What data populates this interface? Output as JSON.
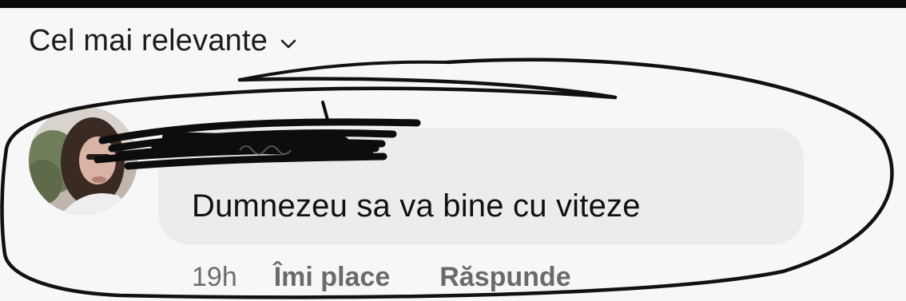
{
  "sort": {
    "label": "Cel mai relevante",
    "chevron_icon": "chevron-down-icon"
  },
  "comment": {
    "avatar_icon": "user-avatar",
    "author_name_redaction": "scribble-redaction",
    "text": "Dumnezeu sa va bine cu viteze",
    "time": "19h",
    "like_label": "Îmi place",
    "reply_label": "Răspunde"
  },
  "annotation": {
    "type": "hand-drawn-circle",
    "color": "#111111"
  },
  "colors": {
    "bubble": "#ececef",
    "background": "#f7f7f8",
    "meta_text": "#6d6d70"
  }
}
